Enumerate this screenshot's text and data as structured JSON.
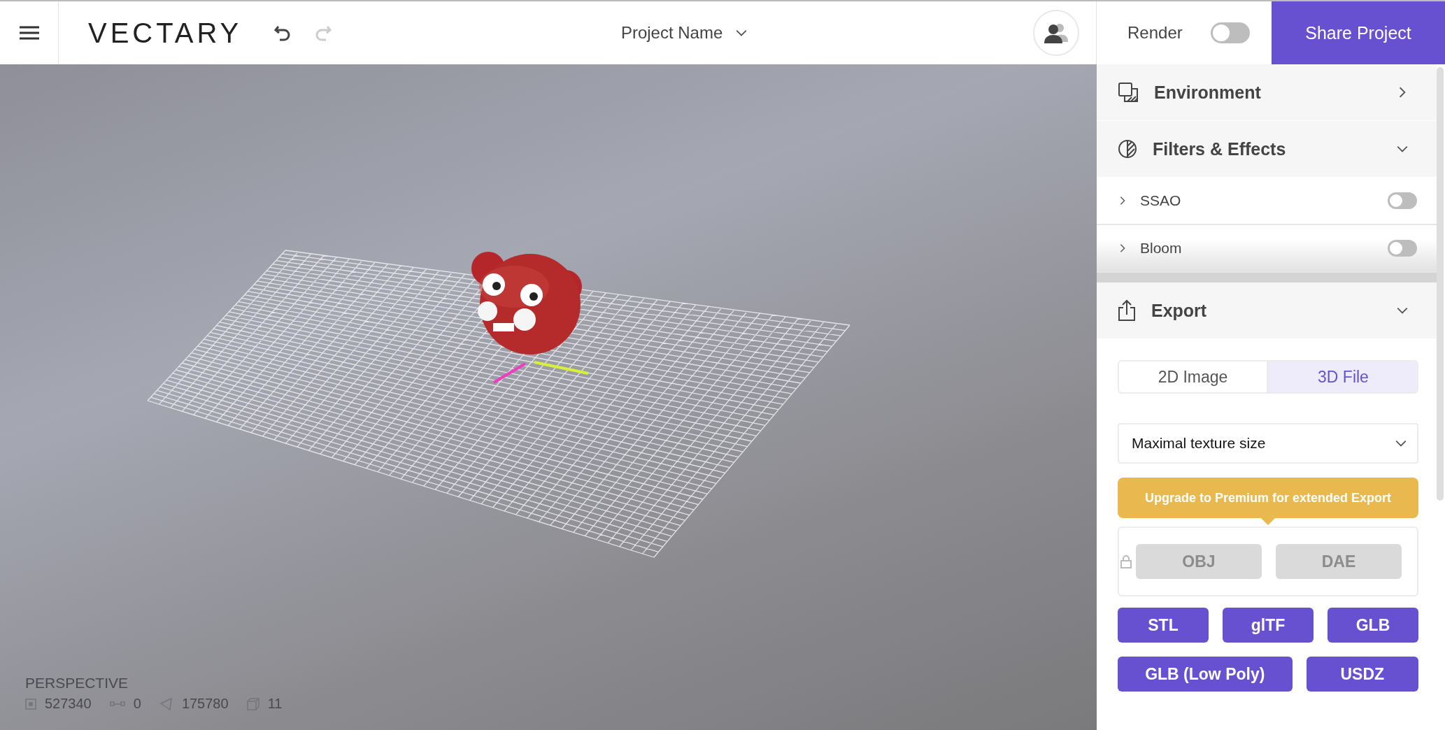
{
  "header": {
    "logo": "VECTARY",
    "project_name": "Project Name",
    "render": {
      "label": "Render",
      "on": false
    },
    "share_button": "Share Project"
  },
  "viewport": {
    "camera": "PERSPECTIVE",
    "stats": [
      {
        "kind": "vertices",
        "value": "527340"
      },
      {
        "kind": "edges",
        "value": "0"
      },
      {
        "kind": "polygons",
        "value": "175780"
      },
      {
        "kind": "objects",
        "value": "11"
      }
    ]
  },
  "panel": {
    "sections": [
      {
        "kind": "environment",
        "title": "Environment",
        "expanded": false
      },
      {
        "kind": "filters",
        "title": "Filters & Effects",
        "expanded": true,
        "effects": [
          {
            "name": "SSAO",
            "on": false,
            "expanded": false
          },
          {
            "name": "Bloom",
            "on": false,
            "expanded": false
          }
        ]
      },
      {
        "kind": "export",
        "title": "Export",
        "expanded": true
      }
    ],
    "export": {
      "tabs": [
        {
          "label": "2D Image",
          "selected": false
        },
        {
          "label": "3D File",
          "selected": true
        }
      ],
      "texture_select": {
        "value": "Maximal texture size"
      },
      "upgrade_banner": "Upgrade to Premium for extended Export",
      "locked_formats": [
        {
          "label": "OBJ",
          "disabled": true
        },
        {
          "label": "DAE",
          "disabled": true
        }
      ],
      "format_rows": [
        [
          "STL",
          "glTF",
          "GLB"
        ],
        [
          "GLB (Low Poly)",
          "USDZ"
        ]
      ]
    }
  }
}
